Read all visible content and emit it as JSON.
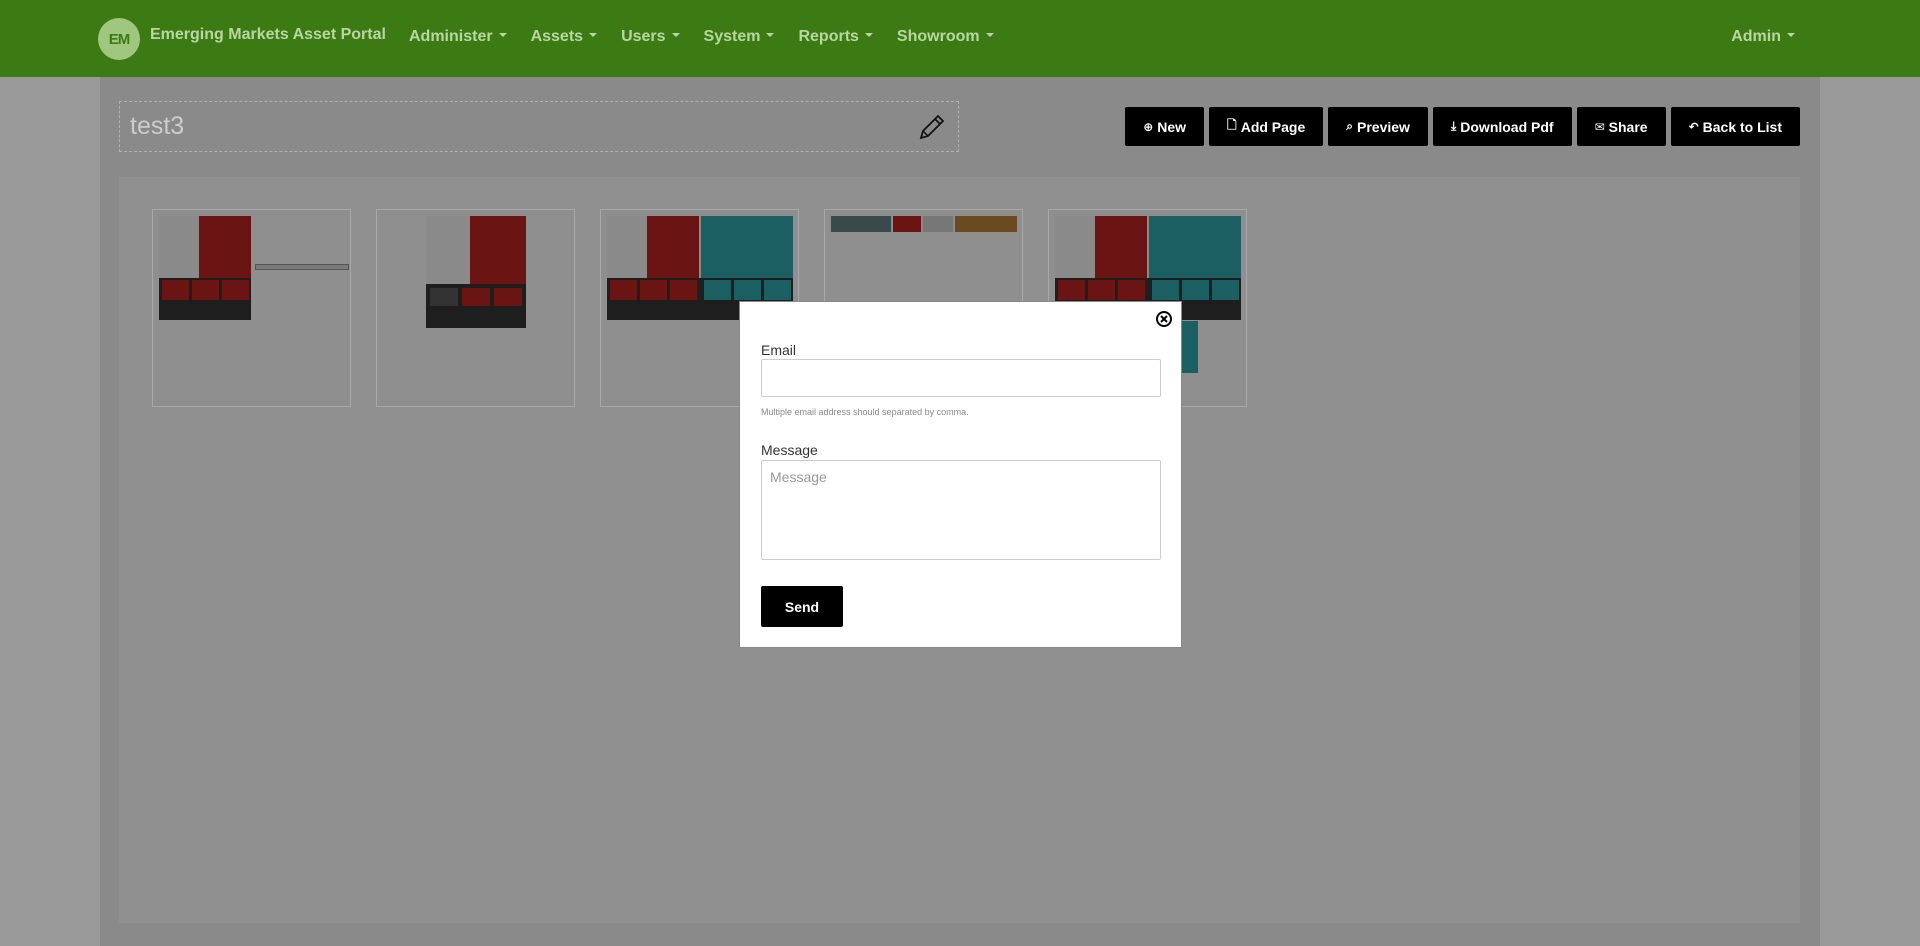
{
  "navbar": {
    "brand_logo": "EM",
    "brand_title": "Emerging Markets Asset Portal",
    "menu": [
      {
        "label": "Administer"
      },
      {
        "label": "Assets"
      },
      {
        "label": "Users"
      },
      {
        "label": "System"
      },
      {
        "label": "Reports"
      },
      {
        "label": "Showroom"
      }
    ],
    "user_label": "Admin",
    "color": "#3c7b13"
  },
  "page": {
    "title": "test3",
    "edit_icon": "pencil-icon"
  },
  "toolbar": {
    "buttons": [
      {
        "label": "New",
        "icon": "plus-circle-icon"
      },
      {
        "label": "Add Page",
        "icon": "file-icon"
      },
      {
        "label": "Preview",
        "icon": "zoom-icon"
      },
      {
        "label": "Download Pdf",
        "icon": "download-icon"
      },
      {
        "label": "Share",
        "icon": "envelope-icon"
      },
      {
        "label": "Back to List",
        "icon": "reply-icon"
      }
    ]
  },
  "thumbnails": [
    {
      "name": "page-1"
    },
    {
      "name": "page-2"
    },
    {
      "name": "page-3"
    },
    {
      "name": "page-4"
    },
    {
      "name": "page-5"
    }
  ],
  "share_modal": {
    "close_icon": "close-circle-icon",
    "email_label": "Email",
    "email_value": "",
    "email_help": "Multiple email address should separated by comma.",
    "message_label": "Message",
    "message_placeholder": "Message",
    "send_label": "Send"
  }
}
